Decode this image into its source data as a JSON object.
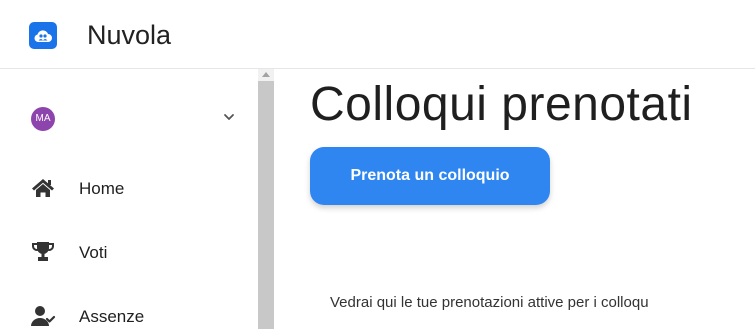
{
  "app": {
    "name": "Nuvola",
    "logo_icon": "cloud-people-icon",
    "accent_color": "#1a73e8"
  },
  "sidebar": {
    "user": {
      "initials": "MA",
      "avatar_color": "#8e44ad",
      "expand_icon": "chevron-down-icon"
    },
    "items": [
      {
        "label": "Home",
        "icon": "home-icon"
      },
      {
        "label": "Voti",
        "icon": "trophy-icon"
      },
      {
        "label": "Assenze",
        "icon": "user-check-icon"
      }
    ]
  },
  "main": {
    "title": "Colloqui prenotati",
    "book_button_label": "Prenota un colloquio",
    "button_color": "#2f86f0",
    "info_text": "Vedrai qui le tue prenotazioni attive per i colloqu"
  }
}
